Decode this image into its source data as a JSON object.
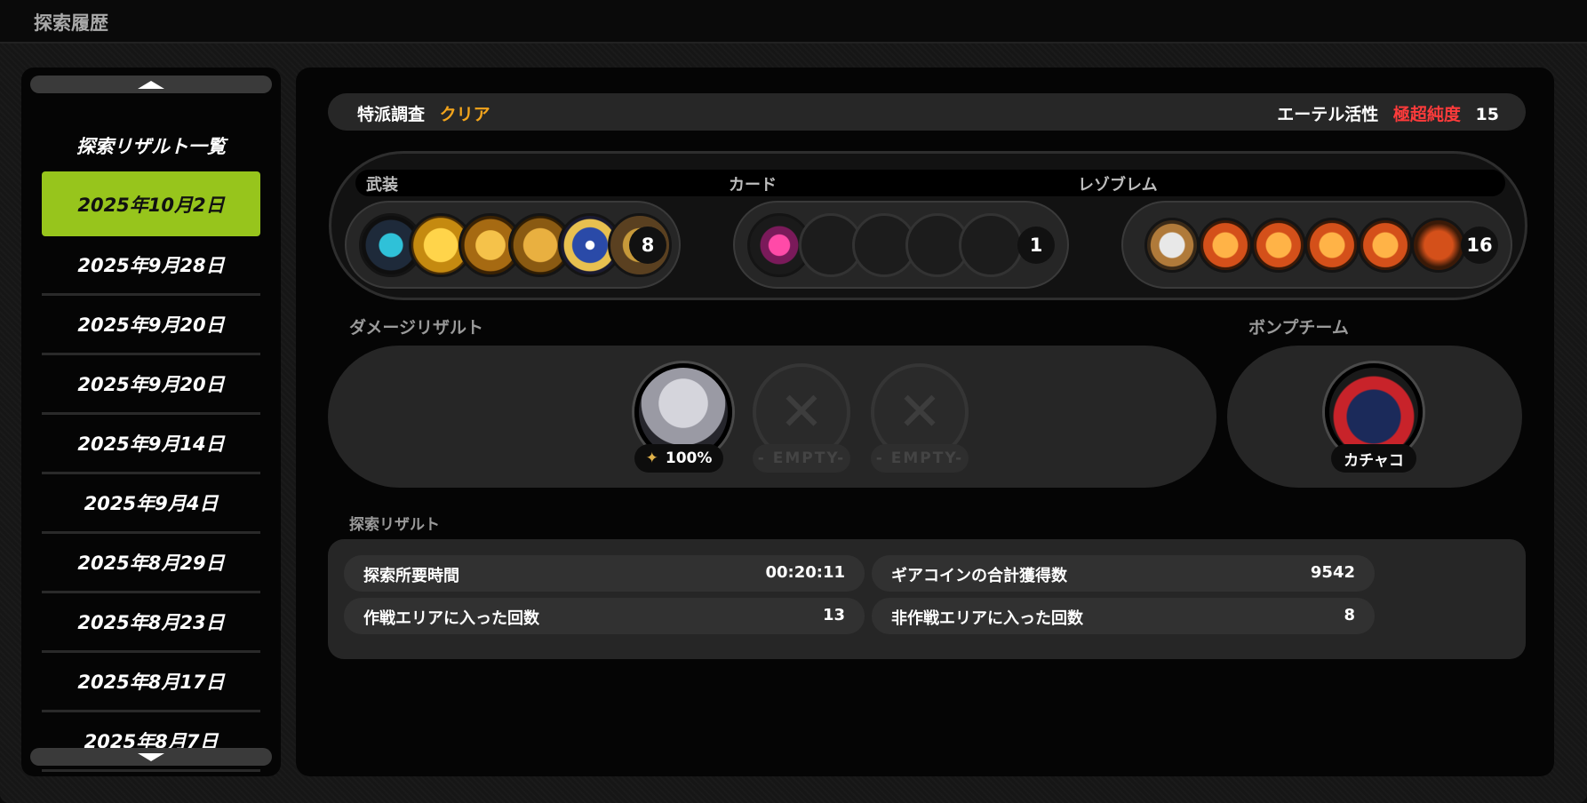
{
  "window": {
    "title": "探索履歴"
  },
  "sidebar": {
    "heading": "探索リザルト一覧",
    "dates": [
      "2025年10月2日",
      "2025年9月28日",
      "2025年9月20日",
      "2025年9月20日",
      "2025年9月14日",
      "2025年9月4日",
      "2025年8月29日",
      "2025年8月23日",
      "2025年8月17日",
      "2025年8月7日"
    ],
    "selected_index": 0
  },
  "topbar": {
    "mode_label": "特派調査",
    "mode_status": "クリア",
    "ether_label": "エーテル活性",
    "ether_grade": "極超純度",
    "ether_value": "15"
  },
  "equipment": {
    "weapons": {
      "label": "武装",
      "count": "8"
    },
    "cards": {
      "label": "カード",
      "count": "1"
    },
    "resonance": {
      "label": "レゾブレム",
      "count": "16"
    }
  },
  "damage": {
    "label": "ダメージリザルト",
    "member_percent": "100%",
    "empty_label_1": "- EMPTY-",
    "empty_label_2": "- EMPTY-"
  },
  "bomb_team": {
    "label": "ボンプチーム",
    "name": "カチャコ"
  },
  "results": {
    "label": "探索リザルト",
    "stats": [
      {
        "label": "探索所要時間",
        "value": "00:20:11"
      },
      {
        "label": "ギアコインの合計獲得数",
        "value": "9542"
      },
      {
        "label": "作戦エリアに入った回数",
        "value": "13"
      },
      {
        "label": "非作戦エリアに入った回数",
        "value": "8"
      }
    ]
  },
  "colors": {
    "accent_green": "#97c51c",
    "status_orange": "#f2a41c",
    "grade_red": "#ff3b3b"
  }
}
